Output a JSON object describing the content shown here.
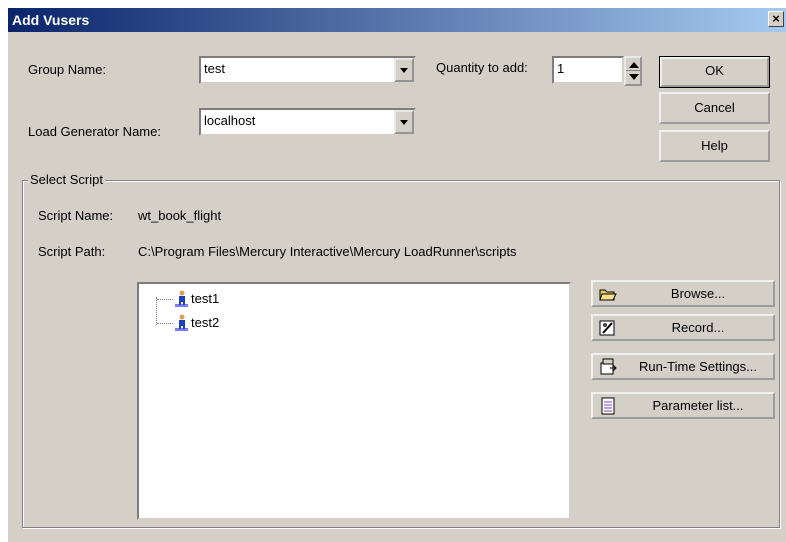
{
  "window": {
    "title": "Add Vusers",
    "close_label": "×"
  },
  "form": {
    "group_name_label": "Group Name:",
    "group_name_value": "test",
    "quantity_label": "Quantity to add:",
    "quantity_value": "1",
    "load_generator_label": "Load Generator Name:",
    "load_generator_value": "localhost"
  },
  "buttons": {
    "ok": "OK",
    "cancel": "Cancel",
    "help": "Help"
  },
  "select_script": {
    "legend": "Select Script",
    "script_name_label": "Script Name:",
    "script_name_value": "wt_book_flight",
    "script_path_label": "Script Path:",
    "script_path_value": "C:\\Program Files\\Mercury Interactive\\Mercury LoadRunner\\scripts",
    "scripts": [
      "test1",
      "test2"
    ],
    "actions": {
      "browse": "Browse...",
      "record": "Record...",
      "runtime": "Run-Time Settings...",
      "params": "Parameter list..."
    }
  },
  "colors": {
    "title_start": "#0a246a",
    "title_end": "#a6caf0",
    "face": "#d4d0c8"
  }
}
